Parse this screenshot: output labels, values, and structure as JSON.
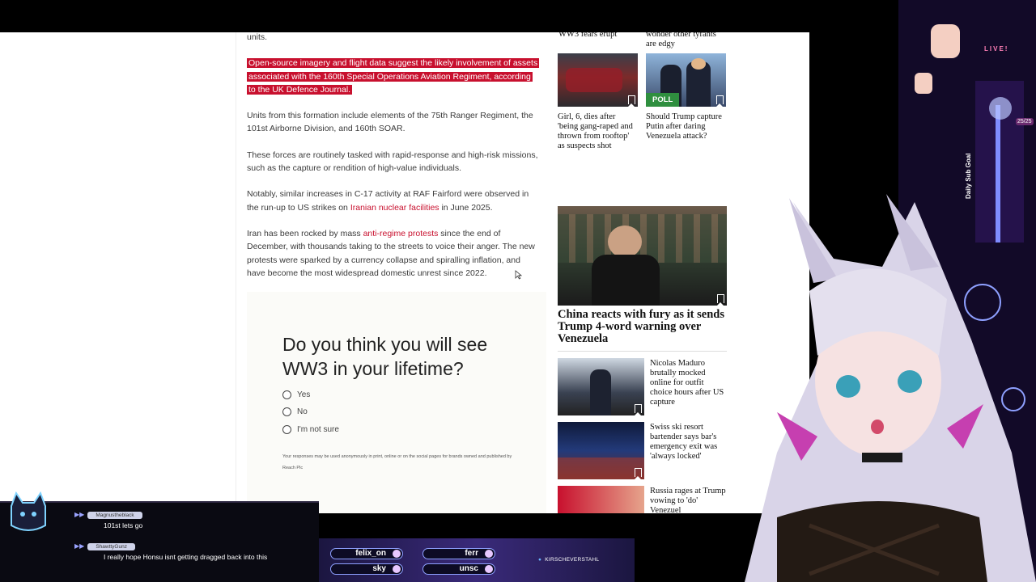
{
  "article": {
    "units_tail": "units.",
    "highlight": "Open-source imagery and flight data suggest the likely involvement of assets associated with the 160th Special Operations Aviation Regiment, according to the UK Defence Journal.",
    "p2": "Units from this formation include elements of the 75th Ranger Regiment, the 101st Airborne Division, and 160th SOAR.",
    "p3": "These forces are routinely tasked with rapid-response and high-risk missions, such as the capture or rendition of high-value individuals.",
    "p4_a": "Notably, similar increases in C-17 activity at RAF Fairford were observed in the run-up to US strikes on ",
    "p4_link": "Iranian nuclear facilities",
    "p4_b": " in June 2025.",
    "p5_a": "Iran has been rocked by mass ",
    "p5_link": "anti-regime protests",
    "p5_b": " since the end of December, with thousands taking to the streets to voice their anger. The new protests were sparked by a currency collapse and spiralling inflation, and have become the most widespread domestic unrest since 2022."
  },
  "poll": {
    "question": "Do you think you will see WW3 in your lifetime?",
    "options": [
      "Yes",
      "No",
      "I'm not sure"
    ],
    "fine_print": "Your responses may be used anonymously in print, online or on the social pages for brands owned and published by Reach Plc"
  },
  "rail": {
    "top_left_tail": "WW3 fears erupt",
    "top_right_tail": "wonder other tyrants are edgy",
    "card1_title": "Girl, 6, dies after 'being gang-raped and thrown from rooftop' as suspects shot",
    "card2_tag": "POLL",
    "card2_title": "Should Trump capture Putin after daring Venezuela attack?",
    "big_title": "China reacts with fury as it sends Trump 4-word warning over Venezuela",
    "list": [
      "Nicolas Maduro brutally mocked online for outfit choice hours after US capture",
      "Swiss ski resort bartender says bar's emergency exit was 'always locked'",
      "Russia rages at Trump vowing to 'do' Venezuel"
    ]
  },
  "chat": {
    "messages": [
      {
        "user": "Magnustheblack",
        "text": "101st lets go"
      },
      {
        "user": "ShawttyGunz",
        "text": "I really hope Honsu isnt getting dragged back into this"
      }
    ]
  },
  "stream": {
    "goal_names": [
      "felix_on",
      "ferr",
      "sky",
      "unsc"
    ],
    "social_handle": "KIRSCHEVERSTAHL",
    "live_label": "LIVE!",
    "sub_goal_label": "Daily Sub Goal",
    "sub_goal_count": "25/25"
  }
}
